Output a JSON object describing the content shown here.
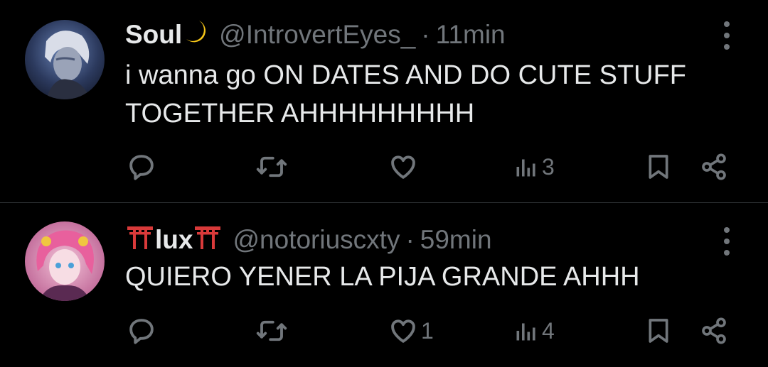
{
  "colors": {
    "background": "#000000",
    "text": "#e7e9ea",
    "muted": "#71767b",
    "divider": "#2f3336"
  },
  "tweets": [
    {
      "display_name": "Soul",
      "name_emoji_after": "🌙",
      "handle": "@IntrovertEyes_",
      "separator": "·",
      "time": "11min",
      "text": "i wanna go ON DATES AND DO CUTE STUFF TOGETHER AHHHHHHHHH",
      "actions": {
        "reply": "",
        "retweet": "",
        "like": "",
        "views": "3",
        "bookmark": "",
        "share": ""
      }
    },
    {
      "display_name": "lux",
      "name_emoji_before": "⛩",
      "name_emoji_after": "⛩",
      "handle": "@notoriuscxty",
      "separator": "·",
      "time": "59min",
      "text": "QUIERO YENER LA PIJA GRANDE AHHH",
      "actions": {
        "reply": "",
        "retweet": "",
        "like": "1",
        "views": "4",
        "bookmark": "",
        "share": ""
      }
    }
  ]
}
